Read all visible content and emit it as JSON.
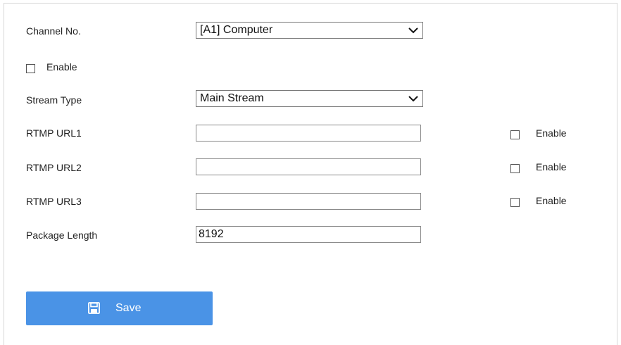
{
  "channel": {
    "label": "Channel No.",
    "selected": "[A1] Computer"
  },
  "enable_main": {
    "label": "Enable",
    "checked": false
  },
  "stream_type": {
    "label": "Stream Type",
    "selected": "Main Stream"
  },
  "rtmp_urls": [
    {
      "label": "RTMP URL1",
      "value": "",
      "enable_label": "Enable",
      "enabled": false
    },
    {
      "label": "RTMP URL2",
      "value": "",
      "enable_label": "Enable",
      "enabled": false
    },
    {
      "label": "RTMP URL3",
      "value": "",
      "enable_label": "Enable",
      "enabled": false
    }
  ],
  "package_length": {
    "label": "Package Length",
    "value": "8192"
  },
  "save_button": {
    "label": "Save",
    "icon": "floppy-disk-icon",
    "color": "#4a93e6"
  }
}
